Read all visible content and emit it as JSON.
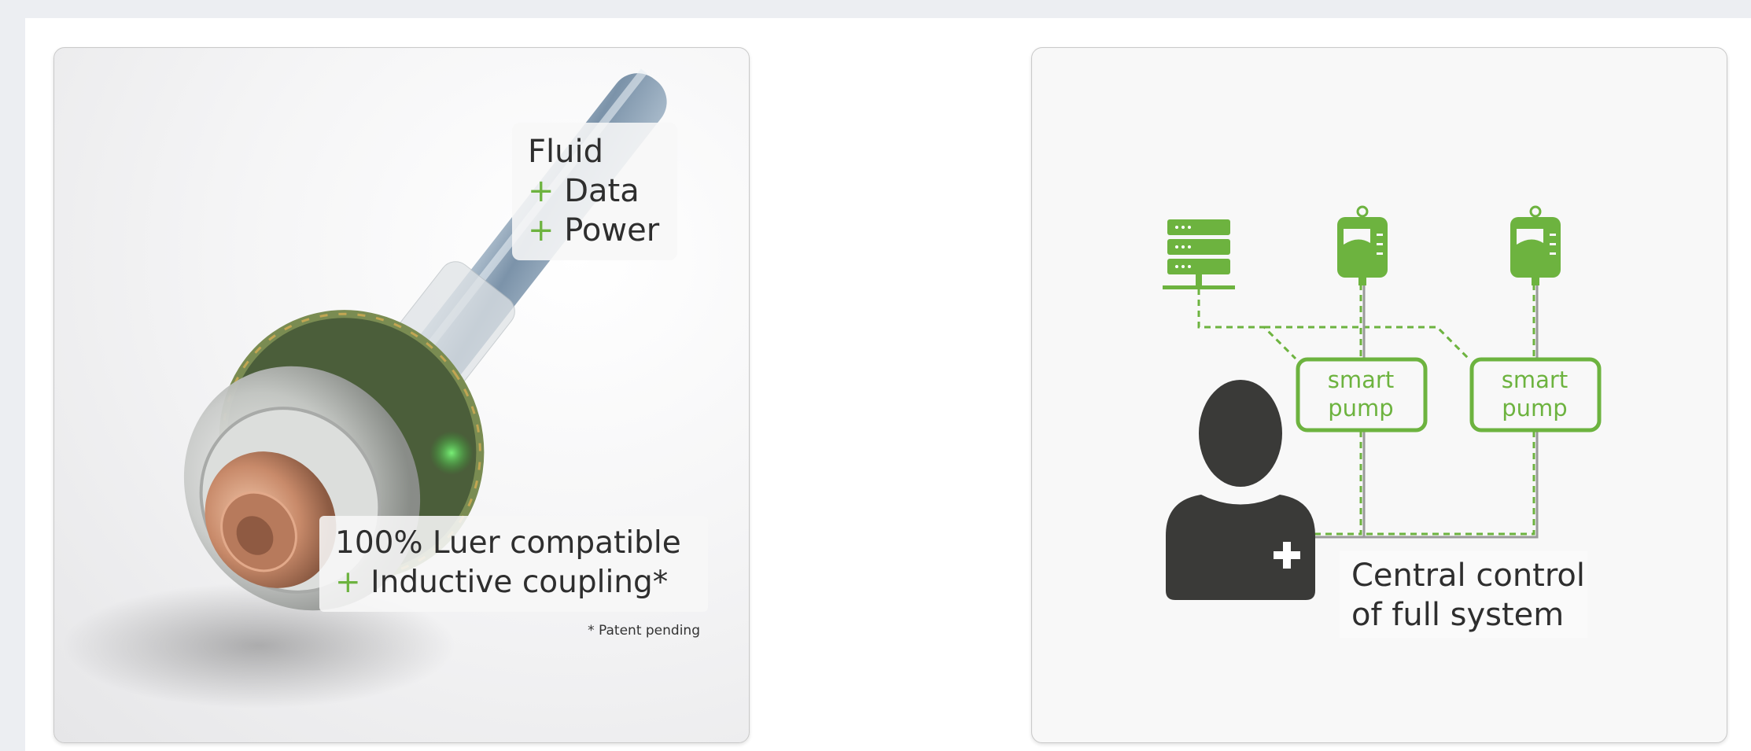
{
  "colors": {
    "accent": "#6db33f",
    "text": "#2e2e2e",
    "dark_icon": "#3a3a38"
  },
  "left_panel": {
    "fluid_label": {
      "line1": "Fluid",
      "line2_plus": "+",
      "line2": "Data",
      "line3_plus": "+",
      "line3": "Power"
    },
    "luer_label": {
      "line1": "100% Luer compatible",
      "line2_plus": "+",
      "line2": "Inductive coupling*"
    },
    "footnote": "* Patent pending"
  },
  "right_panel": {
    "icons": [
      "server-icon",
      "iv-bag-icon",
      "iv-bag-icon",
      "clinician-icon"
    ],
    "pumps": [
      {
        "line1": "smart",
        "line2": "pump"
      },
      {
        "line1": "smart",
        "line2": "pump"
      }
    ],
    "caption": {
      "line1": "Central control",
      "line2": "of full system"
    }
  }
}
